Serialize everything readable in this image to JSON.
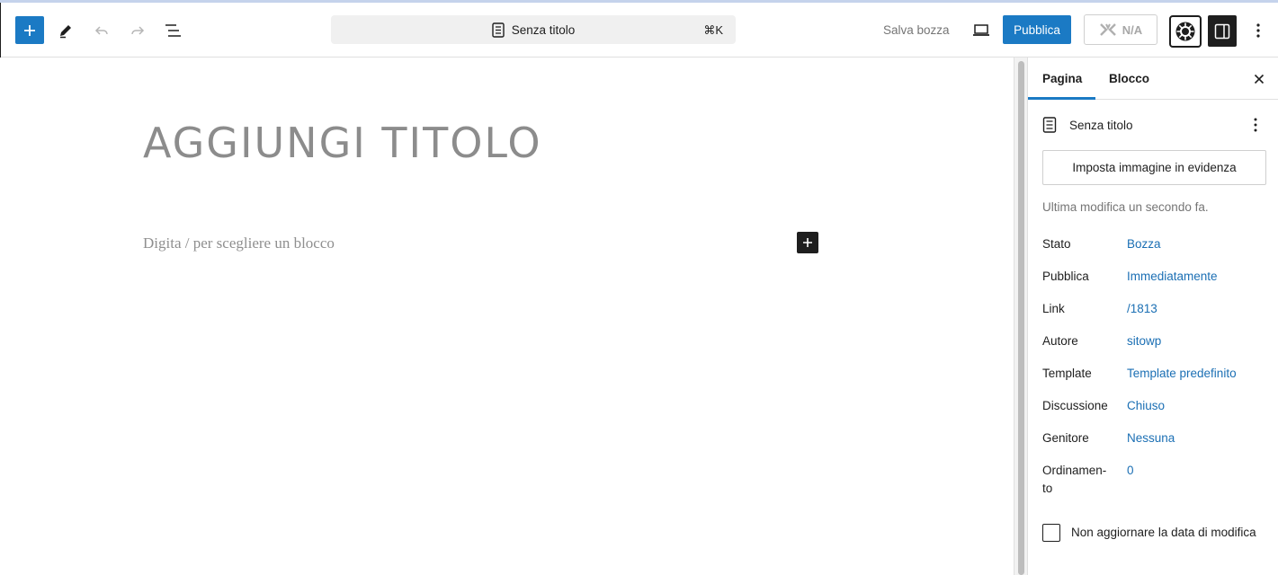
{
  "toolbar": {
    "add_block_icon": "plus-icon",
    "tools_icon": "pencil-icon",
    "undo_icon": "undo-icon",
    "redo_icon": "redo-icon",
    "outline_icon": "list-view-icon",
    "document_title": "Senza titolo",
    "shortcut": "⌘K",
    "save_draft_label": "Salva bozza",
    "preview_icon": "laptop-icon",
    "publish_label": "Pubblica",
    "na_label": "N/A",
    "plugin_icon": "plugin-gear-icon",
    "settings_icon": "sidebar-toggle-icon",
    "options_icon": "kebab-icon",
    "accent_color": "#1b7ac4"
  },
  "editor": {
    "title_placeholder": "AGGIUNGI TITOLO",
    "block_placeholder": "Digita / per scegliere un blocco"
  },
  "sidebar": {
    "tabs": [
      {
        "label": "Pagina",
        "active": true
      },
      {
        "label": "Blocco",
        "active": false
      }
    ],
    "document_name": "Senza titolo",
    "featured_image_label": "Imposta immagine in evidenza",
    "last_modified": "Ultima modifica un secondo fa.",
    "meta": [
      {
        "label": "Stato",
        "value": "Bozza"
      },
      {
        "label": "Pubblica",
        "value": "Immediatamente"
      },
      {
        "label": "Link",
        "value": "/1813"
      },
      {
        "label": "Autore",
        "value": "sitowp"
      },
      {
        "label": "Template",
        "value": "Template predefinito"
      },
      {
        "label": "Discussione",
        "value": "Chiuso"
      },
      {
        "label": "Genitore",
        "value": "Nessuna"
      },
      {
        "label": "Ordinamen-to",
        "value": "0"
      }
    ],
    "checkbox_label": "Non aggiornare la data di modifica"
  }
}
